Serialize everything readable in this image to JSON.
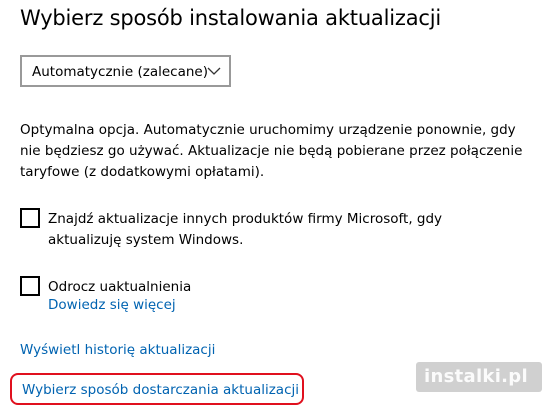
{
  "page": {
    "title": "Wybierz sposób instalowania aktualizacji"
  },
  "dropdown": {
    "selected": "Automatycznie (zalecane)",
    "icon": "chevron-down-icon"
  },
  "description": "Optymalna opcja. Automatycznie uruchomimy urządzenie ponownie, gdy nie będziesz go używać. Aktualizacje nie będą pobierane przez połączenie taryfowe (z dodatkowymi opłatami).",
  "options": {
    "other_products": {
      "label_line1": "Znajdź aktualizacje innych produktów firmy Microsoft, gdy",
      "label_line2": "aktualizuję system Windows.",
      "checked": false
    },
    "defer": {
      "label": "Odrocz uaktualnienia",
      "checked": false,
      "learn_more": "Dowiedz się więcej"
    }
  },
  "links": {
    "history": "Wyświetl historię aktualizacji",
    "delivery": "Wybierz sposób dostarczania aktualizacji"
  },
  "watermark": {
    "text": "instalki.pl"
  },
  "colors": {
    "link": "#0063B1",
    "highlight": "#e0101e",
    "dropdown_border": "#999999"
  }
}
